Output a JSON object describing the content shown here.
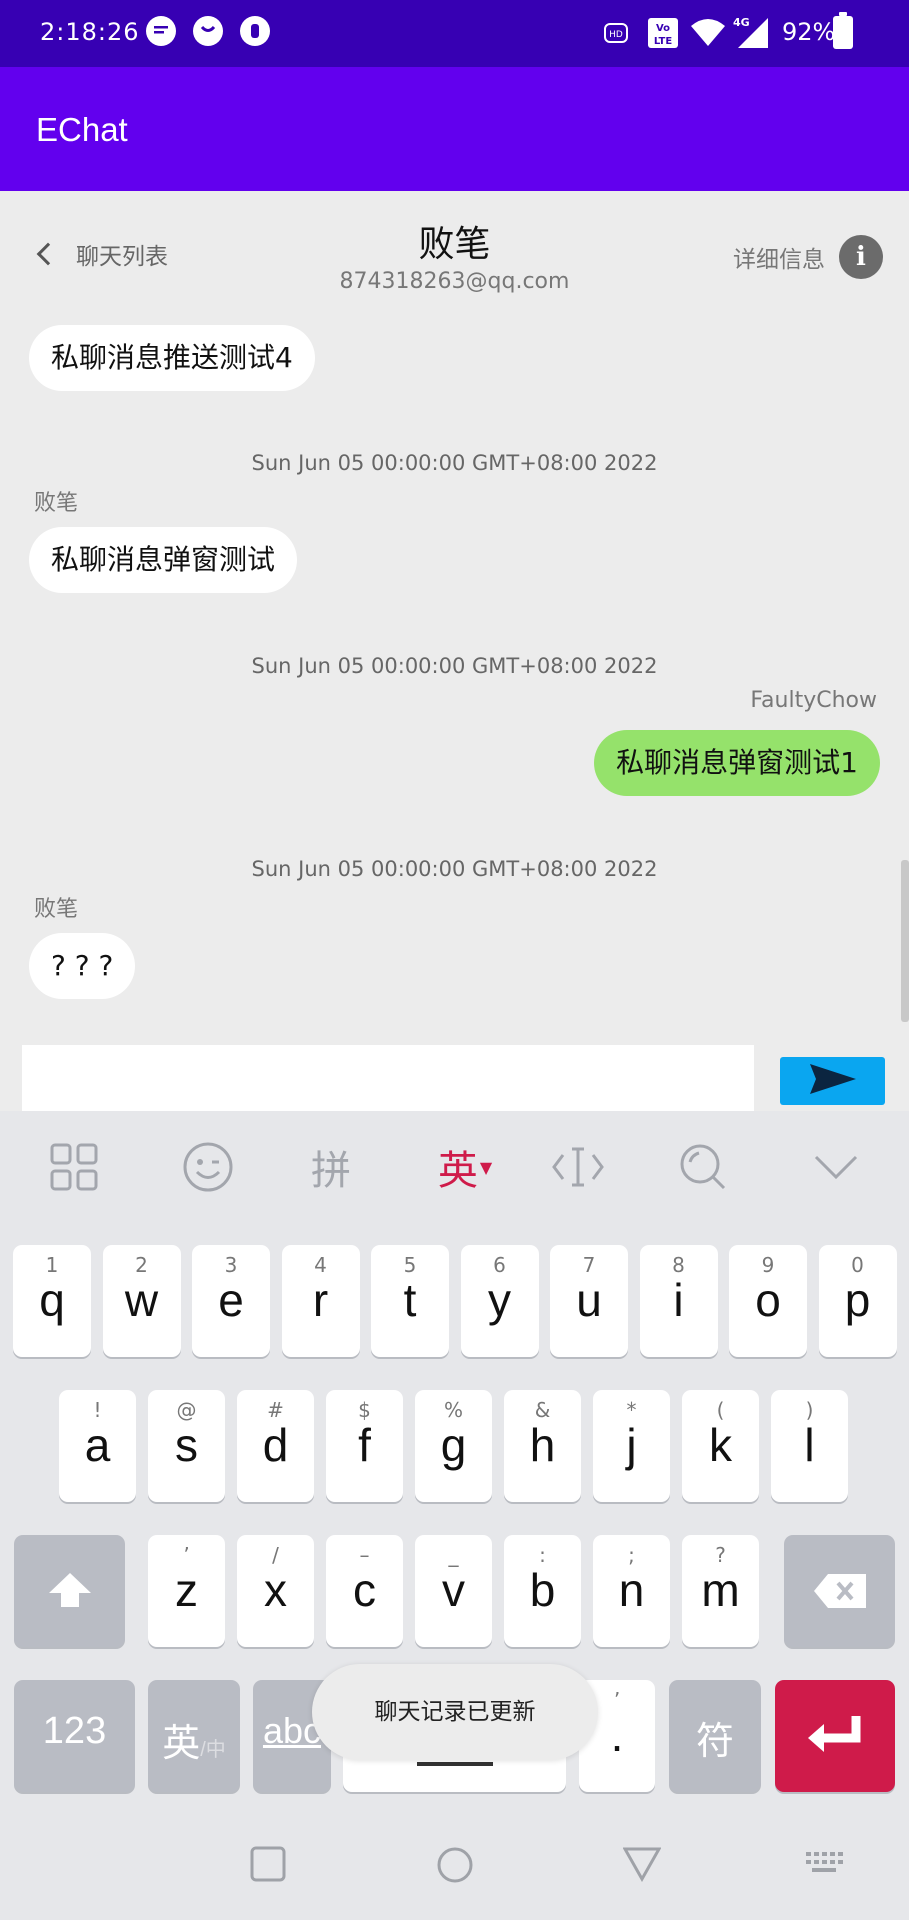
{
  "status_bar": {
    "time": "2:18:26",
    "battery": "92%",
    "network": "4G",
    "volte": "VoLTE"
  },
  "app": {
    "title": "EChat"
  },
  "chat_header": {
    "back_label": "聊天列表",
    "peer_name": "败笔",
    "peer_email": "874318263@qq.com",
    "detail_label": "详细信息",
    "info_glyph": "i"
  },
  "messages": [
    {
      "text": "私聊消息推送测试4",
      "mine": false
    },
    {
      "timestamp": "Sun Jun 05 00:00:00 GMT+08:00 2022",
      "sender": "败笔",
      "text": "私聊消息弹窗测试",
      "mine": false
    },
    {
      "timestamp": "Sun Jun 05 00:00:00 GMT+08:00 2022",
      "sender": "FaultyChow",
      "text": "私聊消息弹窗测试1",
      "mine": true
    },
    {
      "timestamp": "Sun Jun 05 00:00:00 GMT+08:00 2022",
      "sender": "败笔",
      "text": "? ? ?",
      "mine": false
    }
  ],
  "input": {
    "value": "",
    "placeholder": ""
  },
  "keyboard": {
    "toolbar": {
      "pinyin": "拼",
      "english": "英",
      "english_color": "#cf1b4a"
    },
    "row1": [
      {
        "hint": "1",
        "ch": "q"
      },
      {
        "hint": "2",
        "ch": "w"
      },
      {
        "hint": "3",
        "ch": "e"
      },
      {
        "hint": "4",
        "ch": "r"
      },
      {
        "hint": "5",
        "ch": "t"
      },
      {
        "hint": "6",
        "ch": "y"
      },
      {
        "hint": "7",
        "ch": "u"
      },
      {
        "hint": "8",
        "ch": "i"
      },
      {
        "hint": "9",
        "ch": "o"
      },
      {
        "hint": "0",
        "ch": "p"
      }
    ],
    "row2": [
      {
        "hint": "!",
        "ch": "a"
      },
      {
        "hint": "@",
        "ch": "s"
      },
      {
        "hint": "#",
        "ch": "d"
      },
      {
        "hint": "$",
        "ch": "f"
      },
      {
        "hint": "%",
        "ch": "g"
      },
      {
        "hint": "&",
        "ch": "h"
      },
      {
        "hint": "*",
        "ch": "j"
      },
      {
        "hint": "(",
        "ch": "k"
      },
      {
        "hint": ")",
        "ch": "l"
      }
    ],
    "row3": [
      {
        "hint": "’",
        "ch": "z"
      },
      {
        "hint": "/",
        "ch": "x"
      },
      {
        "hint": "–",
        "ch": "c"
      },
      {
        "hint": "_",
        "ch": "v"
      },
      {
        "hint": ":",
        "ch": "b"
      },
      {
        "hint": ";",
        "ch": "n"
      },
      {
        "hint": "?",
        "ch": "m"
      }
    ],
    "bottom": {
      "num_label": "123",
      "lang_label": "英",
      "lang_sub": "/中",
      "abc_label": "abc",
      "period_hint": "’",
      "period_label": ".",
      "symbol_label": "符"
    }
  },
  "toast": {
    "text": "聊天记录已更新"
  },
  "colors": {
    "status_bar": "#3700b3",
    "app_bar": "#6200ee",
    "mine_bubble": "#95e26b",
    "send_button": "#0aa6f0",
    "enter_key": "#cf1b4a"
  }
}
